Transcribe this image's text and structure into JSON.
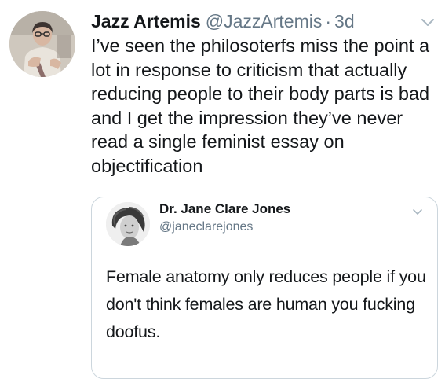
{
  "tweet": {
    "display_name": "Jazz Artemis",
    "handle": "@JazzArtemis",
    "separator": "·",
    "time": "3d",
    "text": "I’ve seen the philosoterfs miss the point a lot in response to criticism that actually reducing people to their body parts is bad and I get the impression they’ve never read a single feminist essay on objectification",
    "caret_icon": "chevron-down-icon"
  },
  "quoted_tweet": {
    "display_name": "Dr. Jane Clare Jones",
    "handle": "@janeclarejones",
    "text": "Female anatomy only reduces people if you don't think females are human you fucking doofus.",
    "caret_icon": "chevron-down-icon"
  },
  "colors": {
    "text_primary": "#14171a",
    "text_secondary": "#657786",
    "border": "#ccd6dd",
    "background": "#ffffff"
  }
}
